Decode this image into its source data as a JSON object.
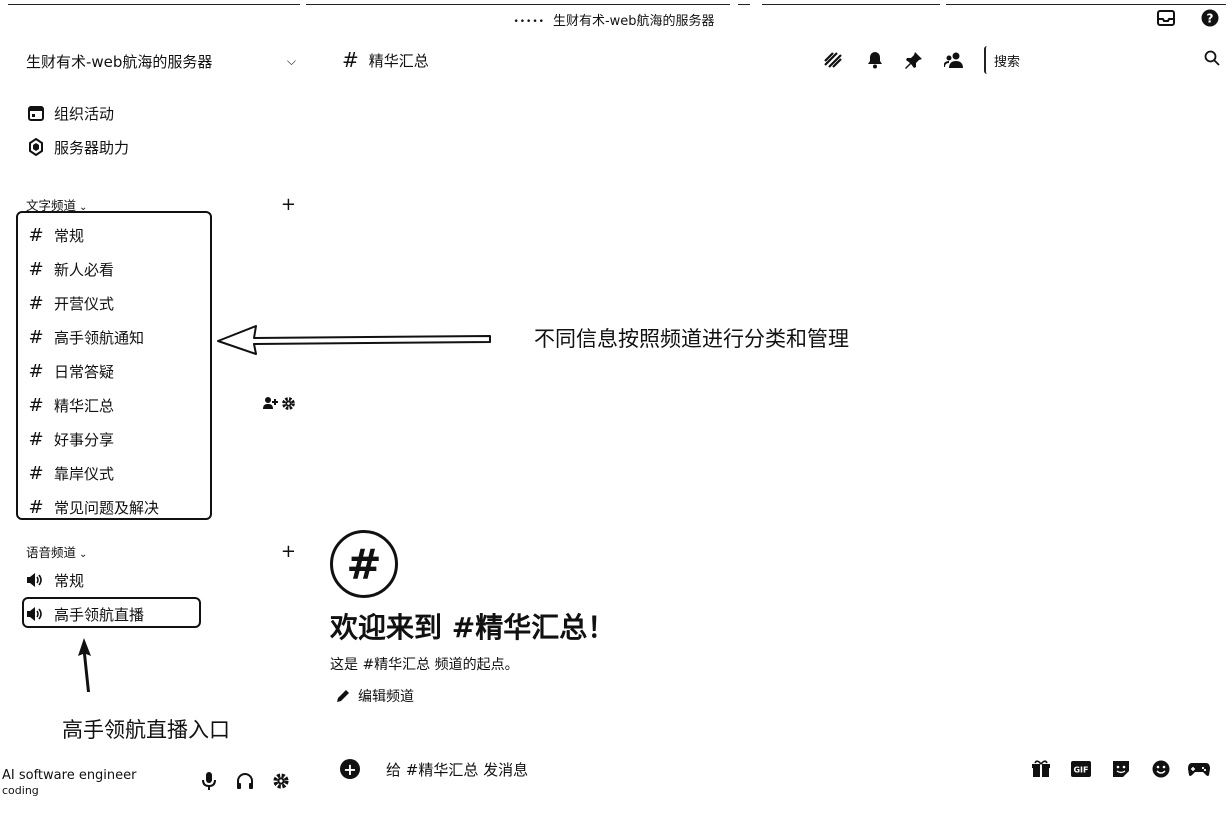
{
  "window": {
    "title": "生财有术-web航海的服务器",
    "dots": "•••••"
  },
  "server": {
    "name": "生财有术-web航海的服务器"
  },
  "sidebar_top": [
    {
      "label": "组织活动",
      "icon": "calendar-icon"
    },
    {
      "label": "服务器助力",
      "icon": "boost-icon"
    }
  ],
  "text_category": {
    "label": "文字频道"
  },
  "text_channels": [
    {
      "label": "常规"
    },
    {
      "label": "新人必看"
    },
    {
      "label": "开营仪式"
    },
    {
      "label": "高手领航通知"
    },
    {
      "label": "日常答疑"
    },
    {
      "label": "精华汇总",
      "selected": true
    },
    {
      "label": "好事分享"
    },
    {
      "label": "靠岸仪式"
    },
    {
      "label": "常见问题及解决"
    }
  ],
  "voice_category": {
    "label": "语音频道"
  },
  "voice_channels": [
    {
      "label": "常规"
    },
    {
      "label": "高手领航直播"
    }
  ],
  "annotations": {
    "channels_note": "不同信息按照频道进行分类和管理",
    "live_note": "高手领航直播入口"
  },
  "user": {
    "name": "AI software engineer",
    "status": "coding"
  },
  "header": {
    "channel": "精华汇总",
    "search_placeholder": "搜索"
  },
  "welcome": {
    "title": "欢迎来到 #精华汇总！",
    "subtitle": "这是 #精华汇总 频道的起点。",
    "edit_label": "编辑频道"
  },
  "composer": {
    "placeholder": "给 #精华汇总 发消息"
  },
  "icons": {
    "header": [
      "threads-icon",
      "bell-icon",
      "pin-icon",
      "members-icon"
    ],
    "composer": [
      "gift-icon",
      "gif-icon",
      "sticker-icon",
      "emoji-icon",
      "game-icon"
    ],
    "user_panel": [
      "microphone-icon",
      "headset-icon",
      "gear-icon"
    ]
  }
}
